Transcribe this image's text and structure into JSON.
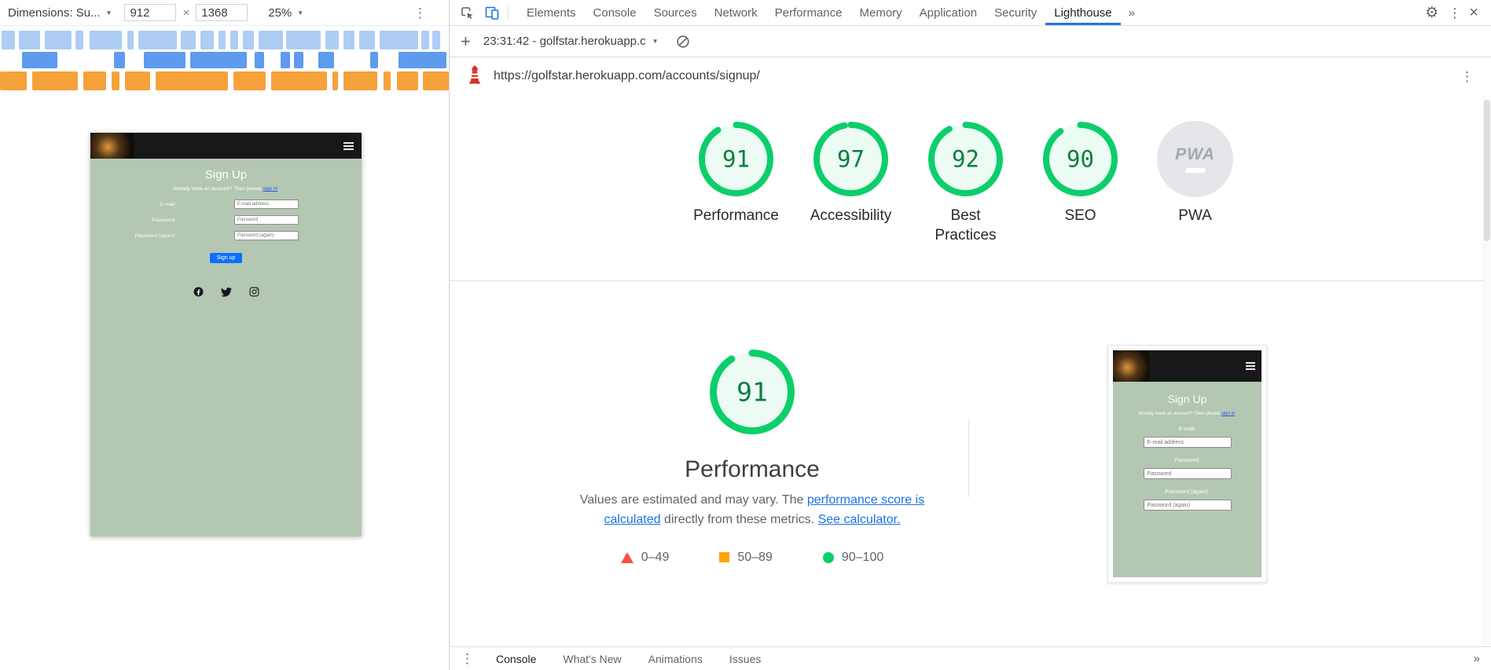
{
  "colors": {
    "pass": "#0cce6b",
    "pass_text": "#0b7f41",
    "pass_fill": "rgba(12,206,107,0.08)",
    "average": "#ffa400",
    "fail": "#ff4e42",
    "link": "#1a73e8",
    "mq_row1": "#aecdf5",
    "mq_row2": "#5e9bee",
    "mq_row3": "#f5a23b"
  },
  "device_toolbar": {
    "dimensions_label": "Dimensions: Su...",
    "width_value": "912",
    "multiply": "×",
    "height_value": "1368",
    "zoom_value": "25%"
  },
  "media_queries": {
    "rows": [
      {
        "color_key": "mq_row1",
        "segments": [
          [
            0.4,
            3.0
          ],
          [
            4.2,
            4.7
          ],
          [
            9.9,
            6.1
          ],
          [
            16.9,
            1.7
          ],
          [
            19.9,
            7.2
          ],
          [
            28.3,
            1.5
          ],
          [
            30.9,
            8.5
          ],
          [
            40.2,
            3.4
          ],
          [
            44.6,
            3.0
          ],
          [
            48.6,
            1.7
          ],
          [
            51.4,
            1.7
          ],
          [
            54.1,
            2.5
          ],
          [
            57.7,
            5.3
          ],
          [
            63.8,
            7.6
          ],
          [
            72.5,
            3.0
          ],
          [
            76.5,
            2.5
          ],
          [
            80.1,
            3.4
          ],
          [
            84.6,
            8.5
          ],
          [
            93.9,
            1.7
          ],
          [
            96.4,
            1.7
          ]
        ]
      },
      {
        "color_key": "mq_row2",
        "segments": [
          [
            4.9,
            7.8
          ],
          [
            25.4,
            2.5
          ],
          [
            32.1,
            9.3
          ],
          [
            42.3,
            12.7
          ],
          [
            56.7,
            2.1
          ],
          [
            62.6,
            2.1
          ],
          [
            65.5,
            2.1
          ],
          [
            71.0,
            3.4
          ],
          [
            82.5,
            1.7
          ],
          [
            88.8,
            10.6
          ]
        ]
      },
      {
        "color_key": "mq_row3",
        "segments": [
          [
            0,
            5.9
          ],
          [
            7.2,
            10.1
          ],
          [
            18.6,
            5.1
          ],
          [
            24.9,
            1.7
          ],
          [
            27.9,
            5.5
          ],
          [
            34.7,
            16.1
          ],
          [
            52.0,
            7.2
          ],
          [
            60.5,
            12.3
          ],
          [
            74.0,
            1.3
          ],
          [
            76.5,
            7.6
          ],
          [
            85.4,
            1.7
          ],
          [
            88.4,
            4.7
          ],
          [
            94.3,
            5.7
          ]
        ]
      }
    ]
  },
  "emulated_page": {
    "title": "Sign Up",
    "signin_prefix": "Already have an account? Then please ",
    "signin_link": "sign in",
    "signin_suffix": ".",
    "fields": [
      {
        "label": "E-mail:",
        "placeholder": "E-mail address"
      },
      {
        "label": "Password:",
        "placeholder": "Password"
      },
      {
        "label": "Password (again):",
        "placeholder": "Password (again)"
      }
    ],
    "submit_label": "Sign up",
    "bg_color": "#b3c7b2",
    "button_color": "#0d6efd",
    "social_icons": [
      "facebook",
      "twitter",
      "instagram"
    ]
  },
  "devtools": {
    "tabs": [
      {
        "label": "Elements"
      },
      {
        "label": "Console"
      },
      {
        "label": "Sources"
      },
      {
        "label": "Network"
      },
      {
        "label": "Performance"
      },
      {
        "label": "Memory"
      },
      {
        "label": "Application"
      },
      {
        "label": "Security"
      },
      {
        "label": "Lighthouse",
        "active": true
      }
    ],
    "more_tabs_symbol": "»",
    "close_symbol": "×"
  },
  "lighthouse_panel": {
    "session_label": "23:31:42 - golfstar.herokuapp.c",
    "url": "https://golfstar.herokuapp.com/accounts/signup/",
    "categories": [
      {
        "label": "Performance",
        "score": 91
      },
      {
        "label": "Accessibility",
        "score": 97
      },
      {
        "label": "Best Practices",
        "score": 92
      },
      {
        "label": "SEO",
        "score": 90
      },
      {
        "label": "PWA",
        "score": null,
        "badge": "PWA"
      }
    ],
    "detail": {
      "score": 91,
      "title": "Performance",
      "desc_pre": "Values are estimated and may vary. The ",
      "desc_link1": "performance score is calculated",
      "desc_mid": " directly from these metrics. ",
      "desc_link2": "See calculator.",
      "legend": [
        {
          "shape": "triangle",
          "color_key": "fail",
          "label": "0–49"
        },
        {
          "shape": "square",
          "color_key": "average",
          "label": "50–89"
        },
        {
          "shape": "circle",
          "color_key": "pass",
          "label": "90–100"
        }
      ]
    }
  },
  "drawer": {
    "tabs": [
      {
        "label": "Console",
        "active": true
      },
      {
        "label": "What's New"
      },
      {
        "label": "Animations"
      },
      {
        "label": "Issues"
      }
    ],
    "more_symbol": "»"
  }
}
